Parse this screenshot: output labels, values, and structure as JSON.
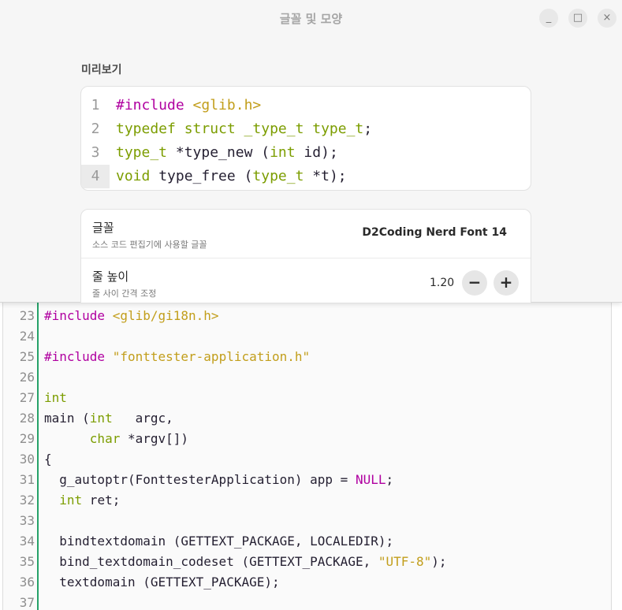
{
  "dialog": {
    "title": "글꼴 및 모양",
    "window_buttons": {
      "minimize": "_",
      "maximize": "□",
      "close": "×"
    },
    "preview_label": "미리보기",
    "preview_lines": [
      {
        "num": "1",
        "parts": [
          {
            "t": "#include ",
            "c": "pp"
          },
          {
            "t": "<glib.h>",
            "c": "str"
          }
        ]
      },
      {
        "num": "2",
        "parts": [
          {
            "t": "typedef struct _type_t type_t",
            "c": "kw"
          },
          {
            "t": ";",
            "c": ""
          }
        ]
      },
      {
        "num": "3",
        "parts": [
          {
            "t": "type_t",
            "c": "kw"
          },
          {
            "t": " *type_new (",
            "c": ""
          },
          {
            "t": "int",
            "c": "kw"
          },
          {
            "t": " id);",
            "c": ""
          }
        ]
      },
      {
        "num": "4",
        "parts": [
          {
            "t": "void",
            "c": "kw"
          },
          {
            "t": " type_free (",
            "c": ""
          },
          {
            "t": "type_t",
            "c": "kw"
          },
          {
            "t": " *t);",
            "c": ""
          }
        ]
      }
    ],
    "current_line": "4",
    "font_row": {
      "title": "글꼴",
      "subtitle": "소스 코드 편집기에 사용할 글꼴",
      "value": "D2Coding Nerd Font 14"
    },
    "line_height_row": {
      "title": "줄 높이",
      "subtitle": "줄 사이 간격 조정",
      "value": "1.20",
      "minus": "−",
      "plus": "+"
    }
  },
  "editor": {
    "lines": [
      {
        "num": "23",
        "parts": [
          {
            "t": "#include ",
            "c": "pp"
          },
          {
            "t": "<glib/gi18n.h>",
            "c": "str"
          }
        ]
      },
      {
        "num": "24",
        "parts": []
      },
      {
        "num": "25",
        "parts": [
          {
            "t": "#include ",
            "c": "pp"
          },
          {
            "t": "\"fonttester-application.h\"",
            "c": "str"
          }
        ]
      },
      {
        "num": "26",
        "parts": []
      },
      {
        "num": "27",
        "parts": [
          {
            "t": "int",
            "c": "kw"
          }
        ]
      },
      {
        "num": "28",
        "parts": [
          {
            "t": "main (",
            "c": ""
          },
          {
            "t": "int",
            "c": "kw"
          },
          {
            "t": "   argc,",
            "c": ""
          }
        ]
      },
      {
        "num": "29",
        "parts": [
          {
            "t": "      ",
            "c": ""
          },
          {
            "t": "char",
            "c": "kw"
          },
          {
            "t": " *argv[])",
            "c": ""
          }
        ]
      },
      {
        "num": "30",
        "parts": [
          {
            "t": "{",
            "c": ""
          }
        ]
      },
      {
        "num": "31",
        "parts": [
          {
            "t": "  g_autoptr(FonttesterApplication) app = ",
            "c": ""
          },
          {
            "t": "NULL",
            "c": "nul"
          },
          {
            "t": ";",
            "c": ""
          }
        ]
      },
      {
        "num": "32",
        "parts": [
          {
            "t": "  ",
            "c": ""
          },
          {
            "t": "int",
            "c": "kw"
          },
          {
            "t": " ret;",
            "c": ""
          }
        ]
      },
      {
        "num": "33",
        "parts": []
      },
      {
        "num": "34",
        "parts": [
          {
            "t": "  bindtextdomain (GETTEXT_PACKAGE, LOCALEDIR);",
            "c": ""
          }
        ]
      },
      {
        "num": "35",
        "parts": [
          {
            "t": "  bind_textdomain_codeset (GETTEXT_PACKAGE, ",
            "c": ""
          },
          {
            "t": "\"UTF-8\"",
            "c": "str"
          },
          {
            "t": ");",
            "c": ""
          }
        ]
      },
      {
        "num": "36",
        "parts": [
          {
            "t": "  textdomain (GETTEXT_PACKAGE);",
            "c": ""
          }
        ]
      },
      {
        "num": "37",
        "parts": []
      }
    ]
  }
}
